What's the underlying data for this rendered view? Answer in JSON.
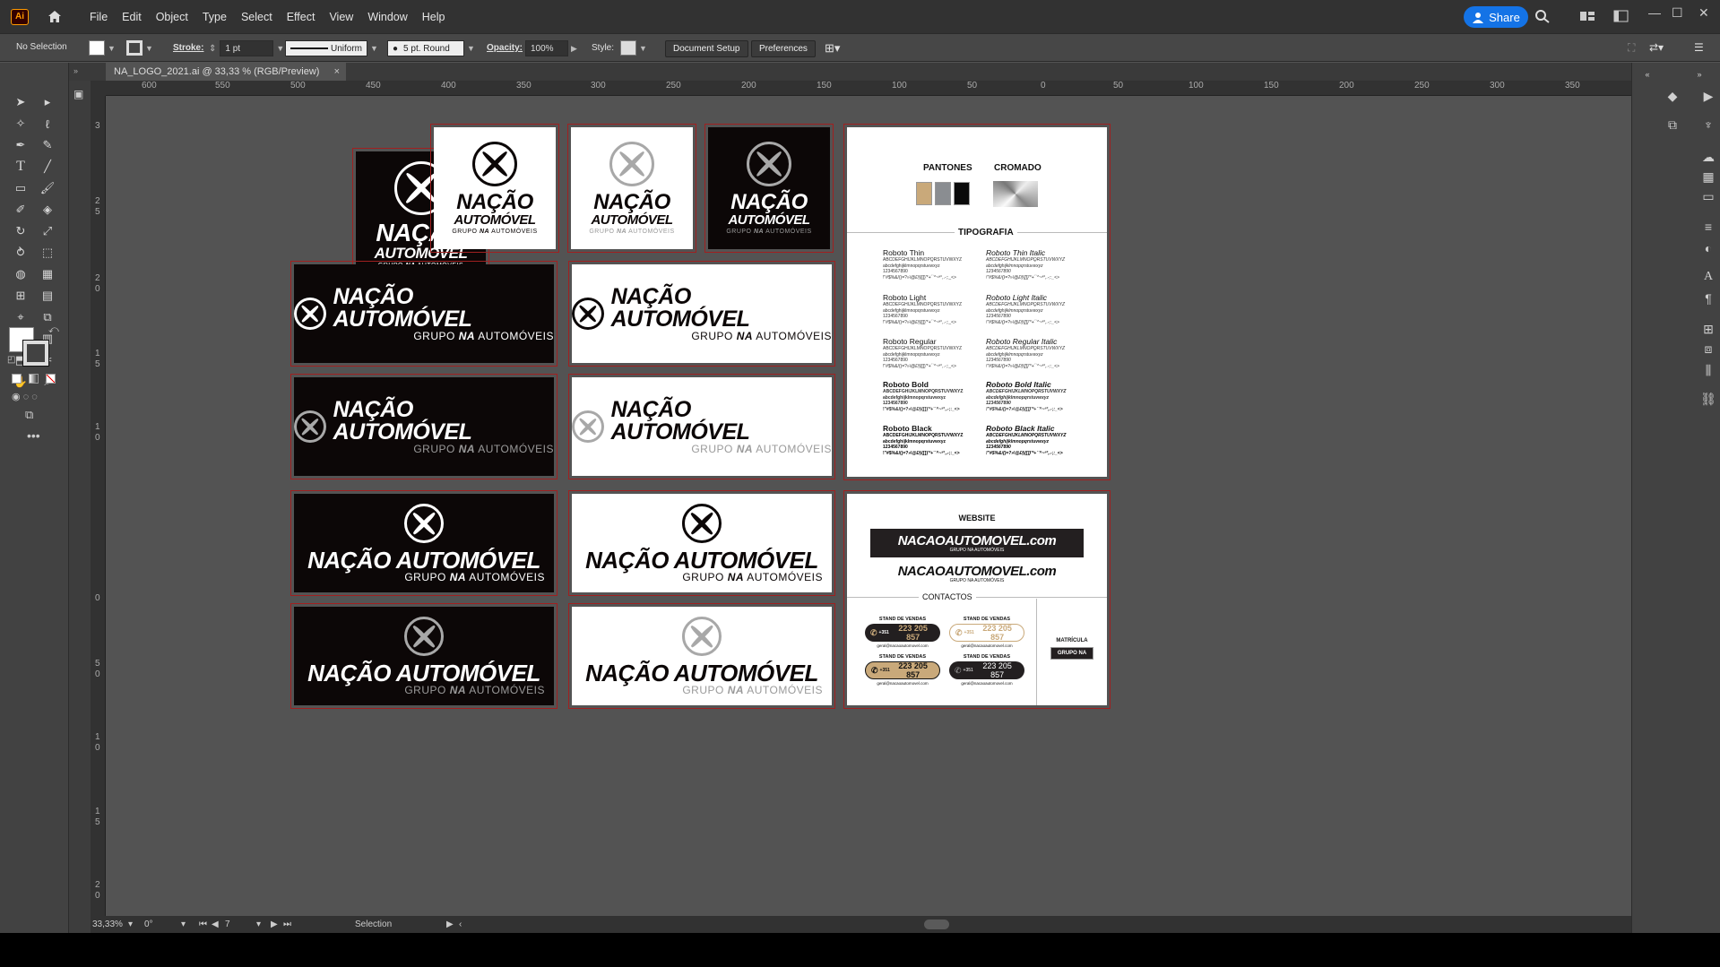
{
  "app": {
    "logo": "Ai",
    "menus": [
      "File",
      "Edit",
      "Object",
      "Type",
      "Select",
      "Effect",
      "View",
      "Window",
      "Help"
    ],
    "share": "Share"
  },
  "control": {
    "selection": "No Selection",
    "stroke_label": "Stroke:",
    "stroke_value": "1 pt",
    "profile": "Uniform",
    "brush": "5 pt. Round",
    "opacity_label": "Opacity:",
    "opacity_value": "100%",
    "style_label": "Style:",
    "doc_setup": "Document Setup",
    "preferences": "Preferences"
  },
  "tab": {
    "title": "NA_LOGO_2021.ai @ 33,33 % (RGB/Preview)",
    "close": "×"
  },
  "ruler": {
    "h": [
      "600",
      "550",
      "500",
      "450",
      "400",
      "350",
      "300",
      "250",
      "200",
      "150",
      "100",
      "50",
      "0",
      "50",
      "100",
      "150",
      "200",
      "250",
      "300",
      "350"
    ],
    "v": [
      "3",
      "2",
      "5",
      "2",
      "0",
      "1",
      "5",
      "1",
      "0",
      "0",
      "5",
      "0",
      "1",
      "0",
      "1",
      "5",
      "2",
      "0"
    ]
  },
  "logo": {
    "line1": "NAÇÃO",
    "line2": "AUTOMÓVEL",
    "full": "NAÇÃO AUTOMÓVEL",
    "sub_a": "GRUPO ",
    "sub_na": "NA",
    "sub_b": " AUTOMÓVEIS"
  },
  "panel1": {
    "pantones": "PANTONES",
    "cromado": "CROMADO",
    "tipografia": "TIPOGRAFIA",
    "pantone_colors": [
      "#c9a97a",
      "#8a8d91",
      "#0a0a0a"
    ],
    "fonts": [
      "Roboto Thin",
      "Roboto Thin Italic",
      "Roboto Light",
      "Roboto Light Italic",
      "Roboto Regular",
      "Roboto Regular Italic",
      "Roboto Bold",
      "Roboto Bold Italic",
      "Roboto Black",
      "Roboto Black Italic"
    ],
    "sample1": "ABCDEFGHIJKLMNOPQRSTUVWXYZ",
    "sample2": "abcdefghijklmnopqrstuvwxyz",
    "sample3": "1234567890",
    "sample4": "!\"#$%&/()=?»\\@£§{[]}'*+´`^~ª°,.-;:_<>"
  },
  "panel2": {
    "website": "WEBSITE",
    "url": "NACAOAUTOMOVEL.com",
    "url_sub": "GRUPO NA AUTOMÓVEIS",
    "contactos": "CONTACTOS",
    "stand": "STAND DE VENDAS",
    "phone_prefix": "+351",
    "phone": "223 205 857",
    "email1": "geral@nacaoautomovel.com",
    "matricula": "MATRÍCULA",
    "plate": "GRUPO NA"
  },
  "status": {
    "zoom": "33,33%",
    "rotate": "0°",
    "artboard": "7",
    "tool": "Selection"
  }
}
